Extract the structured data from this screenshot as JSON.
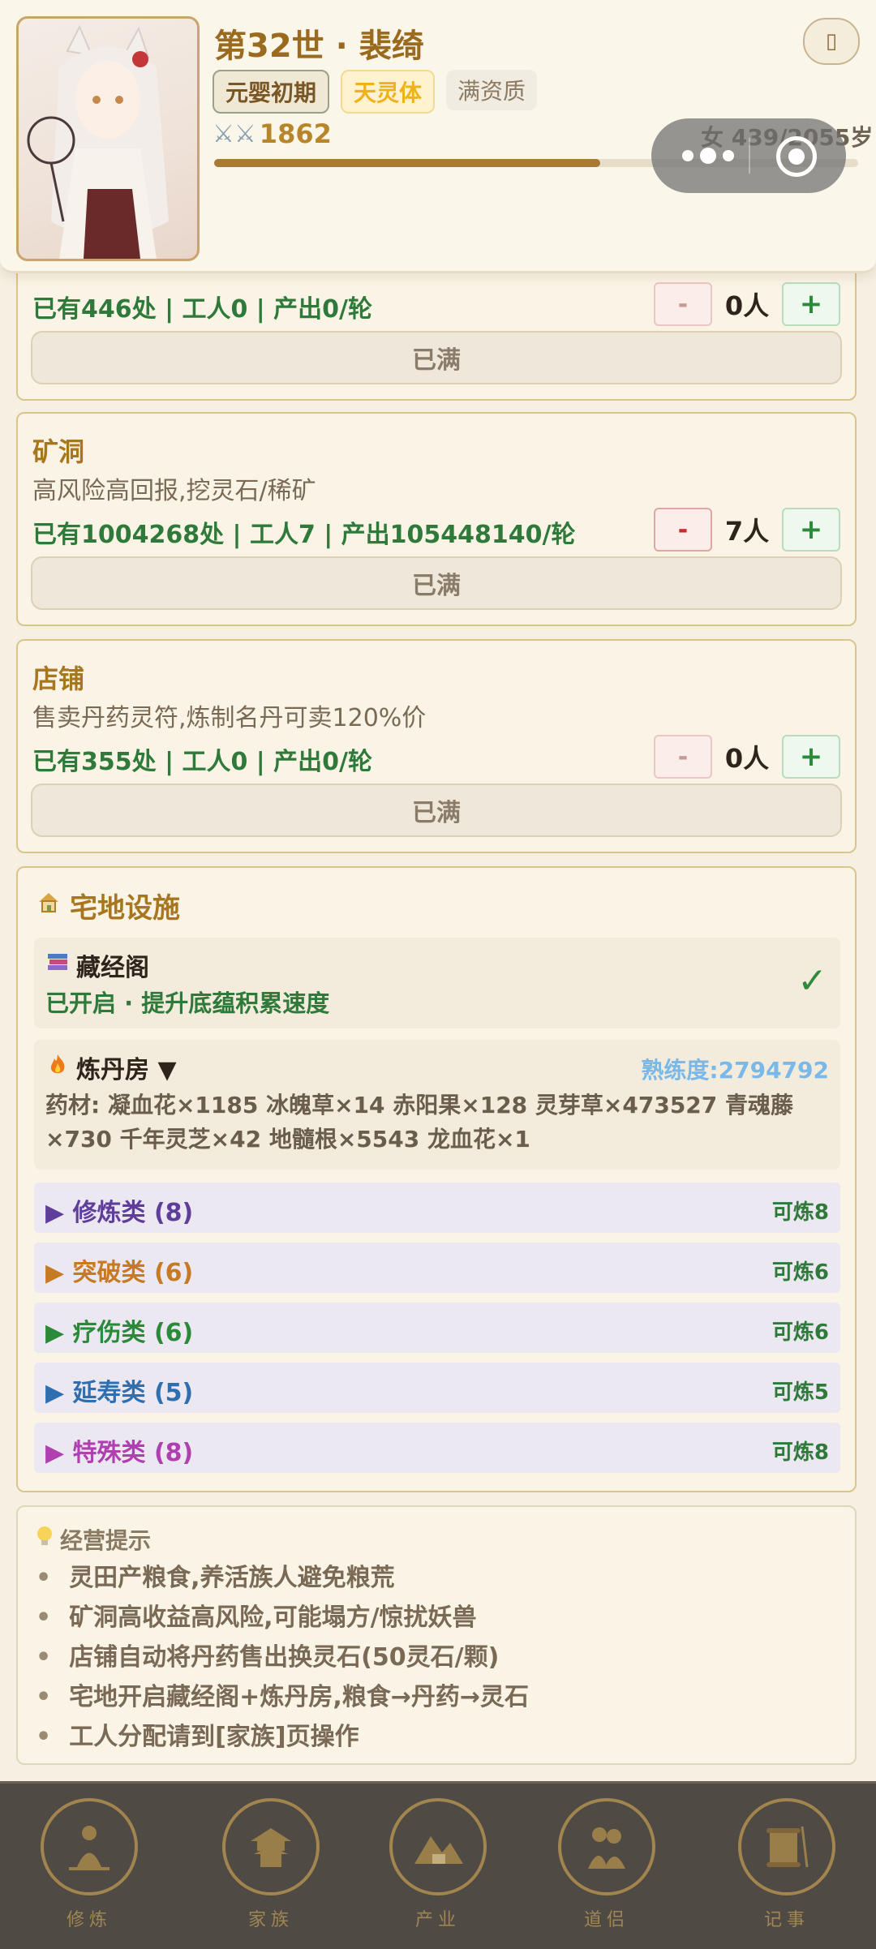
{
  "header": {
    "name": "第32世 · 裴绮",
    "realm": "元婴初期",
    "physique": "天灵体",
    "talent": "满资质",
    "power_icon": "crossed-swords",
    "power": "1862",
    "gender_age": "女 439/2055岁",
    "exp_progress": 0.6,
    "menu_icon": "menu"
  },
  "industries": [
    {
      "name": "",
      "desc": "",
      "stats": "已有446处 | 工人0 | 产出0/轮",
      "minus": "-",
      "count": "0人",
      "plus": "+",
      "button": "已满"
    },
    {
      "name": "矿洞",
      "desc": "高风险高回报,挖灵石/稀矿",
      "stats": "已有1004268处 | 工人7 | 产出105448140/轮",
      "minus": "-",
      "count": "7人",
      "plus": "+",
      "button": "已满"
    },
    {
      "name": "店铺",
      "desc": "售卖丹药灵符,炼制名丹可卖120%价",
      "stats": "已有355处 | 工人0 | 产出0/轮",
      "minus": "-",
      "count": "0人",
      "plus": "+",
      "button": "已满"
    }
  ],
  "facilities": {
    "title": "宅地设施",
    "title_icon": "house",
    "library": {
      "icon": "books",
      "name": "藏经阁",
      "status": "已开启 · 提升底蕴积累速度",
      "check": "✓"
    },
    "alchemy": {
      "icon": "fire",
      "name": "炼丹房 ▼",
      "proficiency": "熟练度:2794792",
      "materials": "药材: 凝血花×1185 冰魄草×14 赤阳果×128 灵芽草×473527 青魂藤×730 千年灵芝×42 地髓根×5543 龙血花×1"
    },
    "categories": [
      {
        "label": "▶ 修炼类 (8)",
        "right": "可炼8",
        "color": "#5e3e9a"
      },
      {
        "label": "▶ 突破类 (6)",
        "right": "可炼6",
        "color": "#c57a23"
      },
      {
        "label": "▶ 疗伤类 (6)",
        "right": "可炼6",
        "color": "#2a8a3a"
      },
      {
        "label": "▶ 延寿类 (5)",
        "right": "可炼5",
        "color": "#2f6fb0"
      },
      {
        "label": "▶ 特殊类 (8)",
        "right": "可炼8",
        "color": "#b040b0"
      }
    ]
  },
  "tips": {
    "icon": "lightbulb",
    "title": "经营提示",
    "items": [
      "灵田产粮食,养活族人避免粮荒",
      "矿洞高收益高风险,可能塌方/惊扰妖兽",
      "店铺自动将丹药售出换灵石(50灵石/颗)",
      "宅地开启藏经阁+炼丹房,粮食→丹药→灵石",
      "工人分配请到[家族]页操作"
    ]
  },
  "tabbar": [
    {
      "label": "修炼",
      "icon": "meditation"
    },
    {
      "label": "家族",
      "icon": "pavilion"
    },
    {
      "label": "产业",
      "icon": "mountains"
    },
    {
      "label": "道侣",
      "icon": "couple"
    },
    {
      "label": "记事",
      "icon": "scroll"
    }
  ]
}
